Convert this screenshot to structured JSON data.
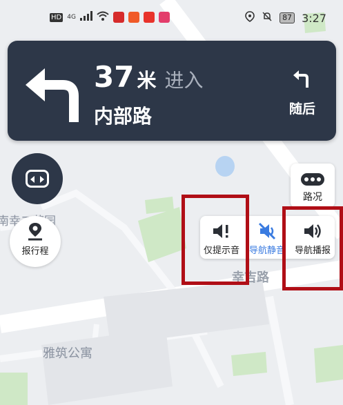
{
  "status_bar": {
    "left_icons": [
      "hd-icon",
      "signal-icon",
      "wifi-icon",
      "mic-app-icon",
      "app-icon",
      "video-app-icon",
      "app-icon-2"
    ],
    "network": "4G",
    "battery": "87",
    "time": "3:27"
  },
  "nav_card": {
    "distance_value": "37",
    "distance_unit": "米",
    "action": "进入",
    "road_name": "内部路",
    "next_label": "随后"
  },
  "map_labels": {
    "area1": "南幸二花园",
    "area2": "雅筑公寓",
    "road": "幸吉路"
  },
  "buttons": {
    "trip": "报行程",
    "traffic": "路况"
  },
  "voice_options": {
    "prompt_only": "仅提示音",
    "nav_mute": "导航静音",
    "nav_broadcast": "导航播报"
  },
  "colors": {
    "card_bg": "#2d3748",
    "accent_blue": "#3a7be0",
    "highlight_red": "#b00e16",
    "map_green": "#cfe8c6"
  }
}
